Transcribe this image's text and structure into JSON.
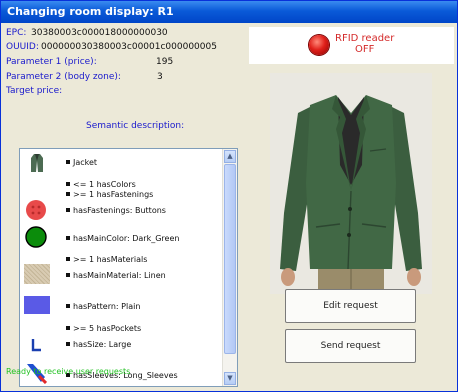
{
  "window": {
    "title": "Changing room display: R1"
  },
  "fields": {
    "epc_label": "EPC:",
    "epc_value": "30380003c000018000000030",
    "ouuid_label": "OUUID:",
    "ouuid_value": "000000030380003c00001c000000005",
    "param1_label": "Parameter 1 (price):",
    "param1_value": "195",
    "param2_label": "Parameter 2 (body zone):",
    "param2_value": "3",
    "target_label": "Target price:"
  },
  "semantic": {
    "title": "Semantic description:",
    "items": [
      "Jacket",
      "<= 1 hasColors",
      ">= 1 hasFastenings",
      "hasFastenings: Buttons",
      "hasMainColor: Dark_Green",
      ">= 1 hasMaterials",
      "hasMainMaterial: Linen",
      "hasPattern: Plain",
      ">= 5 hasPockets",
      "hasSize: Large",
      "hasSleeves: Long_Sleeves"
    ]
  },
  "rfid": {
    "line1": "RFID reader",
    "line2": "OFF",
    "color": "#d42a2a"
  },
  "buttons": {
    "edit": "Edit request",
    "send": "Send request"
  },
  "status": {
    "text": "Ready to receive user requests",
    "color": "#22c122"
  },
  "scrollbar": {
    "up_icon": "▲",
    "down_icon": "▼"
  },
  "icons": [
    "jacket-icon",
    "buttons-icon",
    "dark-green-color-icon",
    "linen-texture-icon",
    "plain-pattern-icon",
    "size-large-icon",
    "long-sleeves-icon"
  ]
}
